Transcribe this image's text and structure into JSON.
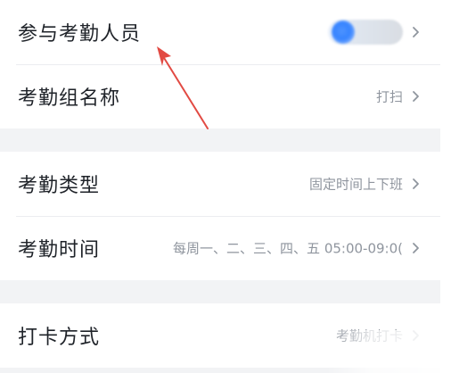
{
  "groups": [
    {
      "rows": [
        {
          "label": "参与考勤人员",
          "value": "",
          "chevron_icon": "chevron-right-icon",
          "avatar_icon": "blurred-avatar-icon"
        },
        {
          "label": "考勤组名称",
          "value": "打扫",
          "chevron_icon": "chevron-right-icon"
        }
      ]
    },
    {
      "rows": [
        {
          "label": "考勤类型",
          "value": "固定时间上下班",
          "chevron_icon": "chevron-right-icon"
        },
        {
          "label": "考勤时间",
          "value": "每周一、二、三、四、五 05:00-09:0(",
          "chevron_icon": "chevron-right-icon"
        }
      ]
    },
    {
      "rows": [
        {
          "label": "打卡方式",
          "value": "考勤机打卡",
          "chevron_icon": "chevron-right-icon"
        }
      ]
    }
  ],
  "colors": {
    "background": "#f2f3f5",
    "card": "#ffffff",
    "label": "#1f2329",
    "value": "#8f959e",
    "divider": "#ebedf0",
    "annotation_arrow": "#e24a43",
    "avatar_blue": "#3784ff"
  },
  "annotation": {
    "icon": "red-arrow-icon"
  }
}
